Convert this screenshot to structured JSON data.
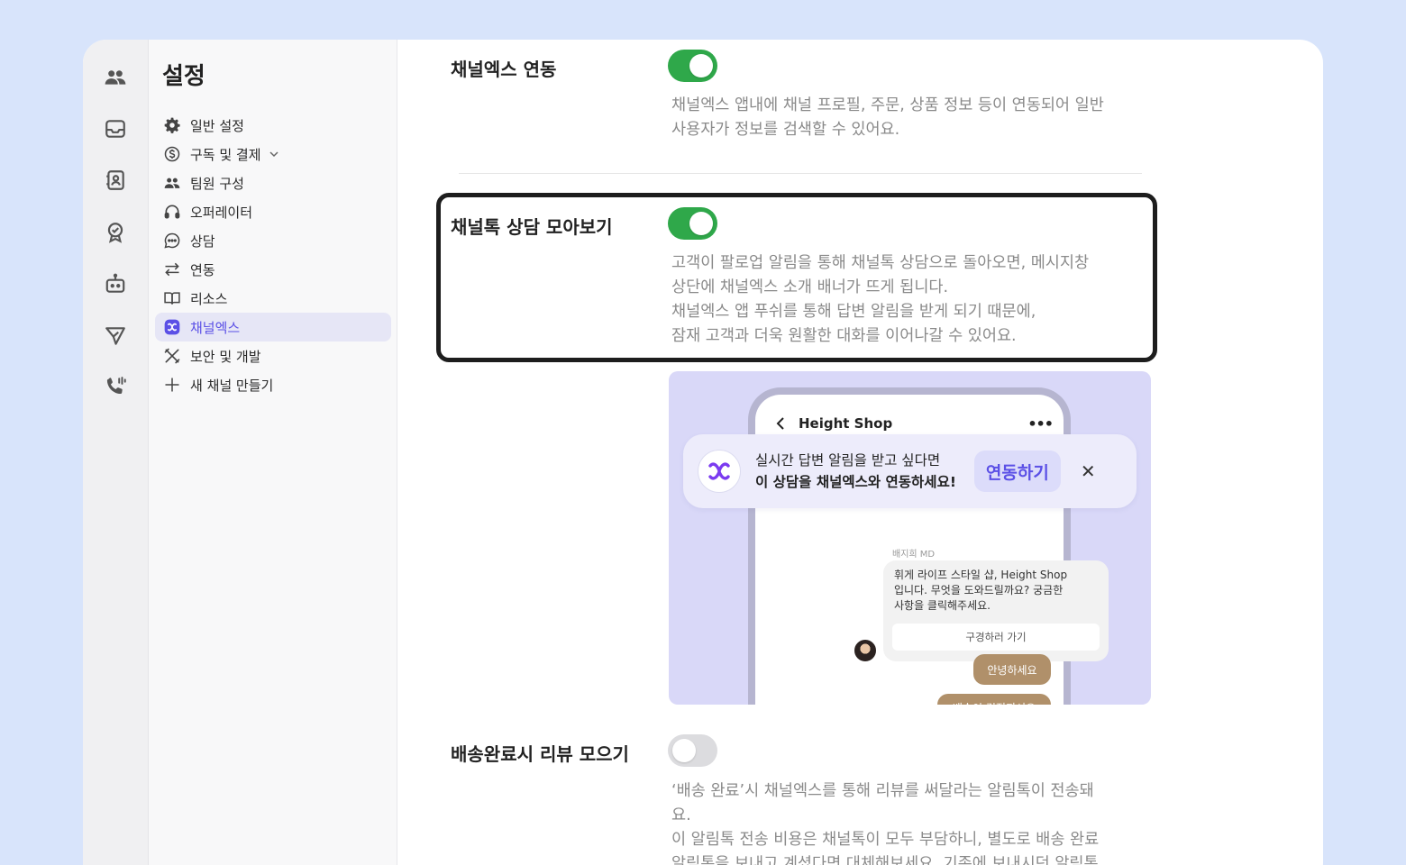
{
  "sidebar": {
    "title": "설정",
    "items": [
      {
        "label": "일반 설정",
        "icon": "gear-icon"
      },
      {
        "label": "구독 및 결제",
        "icon": "dollar-icon"
      },
      {
        "label": "팀원 구성",
        "icon": "team-icon"
      },
      {
        "label": "오퍼레이터",
        "icon": "headset-icon"
      },
      {
        "label": "상담",
        "icon": "chat-icon"
      },
      {
        "label": "연동",
        "icon": "arrows-icon"
      },
      {
        "label": "리소스",
        "icon": "book-icon"
      },
      {
        "label": "채널엑스",
        "icon": "channelx-icon",
        "active": true
      },
      {
        "label": "보안 및 개발",
        "icon": "tools-icon"
      },
      {
        "label": "새 채널 만들기",
        "icon": "plus-icon"
      }
    ]
  },
  "rail": [
    "team-icon",
    "inbox-icon",
    "contacts-icon",
    "badge-icon",
    "bot-icon",
    "send-icon",
    "phone-icon"
  ],
  "settings": {
    "channelx_link": {
      "title": "채널엑스 연동",
      "on": true,
      "desc": [
        "채널엑스 앱내에 채널 프로필, 주문, 상품 정보 등이 연동되어 일반",
        "사용자가 정보를 검색할 수 있어요."
      ]
    },
    "chat_collect": {
      "title": "채널톡 상담 모아보기",
      "on": true,
      "desc": [
        "고객이 팔로업 알림을 통해 채널톡 상담으로 돌아오면, 메시지창",
        "상단에 채널엑스 소개 배너가 뜨게 됩니다.",
        "채널엑스 앱 푸쉬를 통해 답변 알림을 받게 되기 때문에,",
        "잠재 고객과 더욱 원활한 대화를 이어나갈 수 있어요."
      ]
    },
    "review_collect": {
      "title": "배송완료시 리뷰 모으기",
      "on": false,
      "desc": [
        "‘배송 완료’시 채널엑스를 통해 리뷰를 써달라는 알림톡이 전송돼",
        "요.",
        "이 알림톡 전송 비용은 채널톡이 모두 부담하니, 별도로 배송 완료",
        "알림톡을 보내고 계셨다면 대체해보세요. 기존에 보내시던 알림톡"
      ]
    }
  },
  "preview": {
    "shop_name": "Height Shop",
    "more": "•••",
    "banner_line1": "실시간 답변 알림을 받고 싶다면",
    "banner_line2": "이 상담을 채널엑스와 연동하세요!",
    "banner_button": "연동하기",
    "banner_close": "✕",
    "sender": "배지희 MD",
    "message": [
      "휘게 라이프 스타일 샵, Height Shop",
      "입니다. 무엇을 도와드릴까요? 궁금한",
      "사항을 클릭해주세요."
    ],
    "action": "구경하러 가기",
    "replies": [
      "안녕하세요",
      "배송이 걱정되서요"
    ]
  },
  "colors": {
    "accent": "#5b50e6",
    "toggle_on": "#2fa84a",
    "toggle_off": "#dcdcdf",
    "page_bg": "#d8e4fb"
  }
}
